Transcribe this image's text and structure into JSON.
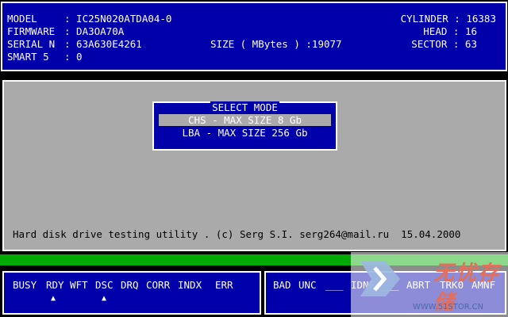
{
  "top_panel": {
    "model_label": "MODEL",
    "model_value": ": IC25N020ATDA04-0",
    "firmware_label": "FIRMWARE",
    "firmware_value": ": DA3OA70A",
    "serial_label": "SERIAL N",
    "serial_value": ": 63A630E4261",
    "smart_label": "SMART 5",
    "smart_value": ": 0",
    "size_text": "SIZE ( MBytes ) :19077",
    "cylinder_text": "CYLINDER : 16383",
    "head_text": "HEAD : 16",
    "sector_text": "SECTOR : 63"
  },
  "dialog": {
    "title": "SELECT MODE",
    "options": [
      "CHS - MAX SIZE 8 Gb",
      "LBA - MAX SIZE 256 Gb"
    ],
    "selected": "CHS - MAX SIZE 8 Gb"
  },
  "footer": {
    "text": "Hard disk drive testing utility . (c) Serg S.I. serg264@mail.ru  15.04.2000"
  },
  "status": {
    "left_flags": [
      "BUSY",
      "RDY",
      "WFT",
      "DSC",
      "DRQ",
      "CORR",
      "INDX",
      "ERR"
    ],
    "active_indicator": "▲",
    "right_flags": [
      "BAD",
      "UNC",
      "___",
      "IDNF",
      "___",
      "ABRT",
      "TRK0",
      "AMNF"
    ]
  },
  "watermark": {
    "title": "无忧存储",
    "url": "WWW.51STOR.CN"
  },
  "colors": {
    "panel_blue": "#0000aa",
    "gray": "#aaaaaa",
    "green": "#00aa00"
  }
}
